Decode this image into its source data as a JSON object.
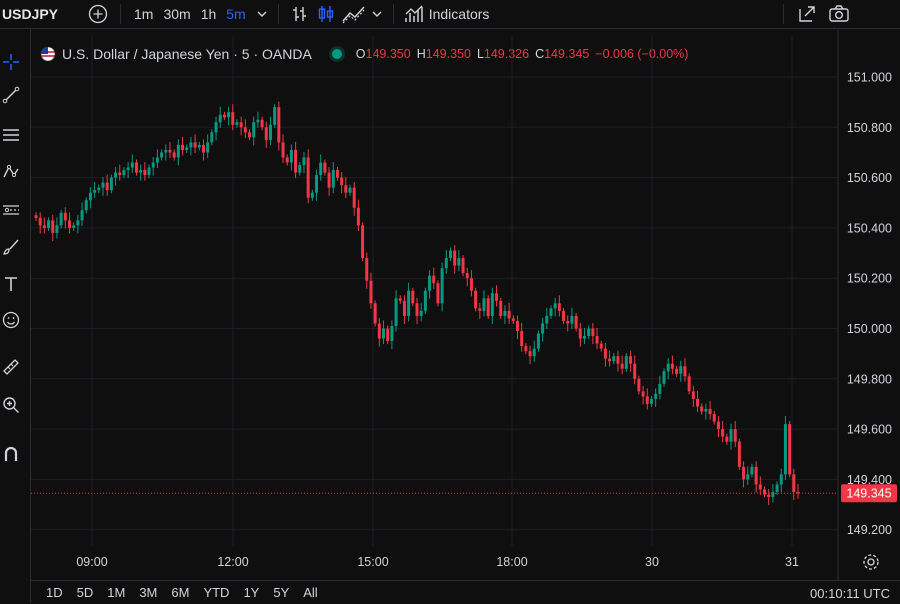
{
  "header": {
    "symbol": "USDJPY",
    "timeframes": [
      "1m",
      "30m",
      "1h",
      "5m"
    ],
    "active_timeframe": "5m",
    "indicators_label": "Indicators",
    "icons": [
      "add-symbol-icon",
      "chevron-down-icon",
      "bar-style-icon",
      "candle-style-icon",
      "area-style-icon",
      "indicators-icon",
      "snapshot-icon",
      "camera-icon"
    ]
  },
  "left_toolbar": {
    "icons": [
      "crosshair-icon",
      "trend-line-icon",
      "fib-icon",
      "pattern-icon",
      "projection-icon",
      "brush-icon",
      "text-icon",
      "emoji-icon",
      "ruler-icon",
      "zoom-icon",
      "magnet-icon"
    ]
  },
  "legend": {
    "title": "U.S. Dollar / Japanese Yen · 5 · OANDA",
    "open_label": "O",
    "open": "149.350",
    "high_label": "H",
    "high": "149.350",
    "low_label": "L",
    "low": "149.326",
    "close_label": "C",
    "close": "149.345",
    "change": "−0.006 (−0.00%)"
  },
  "price_axis": {
    "ticks": [
      "151.000",
      "150.800",
      "150.600",
      "150.400",
      "150.200",
      "150.000",
      "149.800",
      "149.600",
      "149.400",
      "149.200"
    ],
    "current_price": "149.345",
    "current_color": "#f23645"
  },
  "time_axis": {
    "ticks": [
      "09:00",
      "12:00",
      "15:00",
      "18:00",
      "30",
      "31"
    ]
  },
  "bottom_bar": {
    "ranges": [
      "1D",
      "5D",
      "1M",
      "3M",
      "6M",
      "YTD",
      "1Y",
      "5Y",
      "All"
    ],
    "clock": "00:10:11 UTC"
  },
  "colors": {
    "up": "#089981",
    "down": "#f23645",
    "background": "#0f0f0f",
    "accent": "#2962ff"
  },
  "chart_data": {
    "type": "candlestick",
    "ylim": [
      149.17,
      151.13
    ],
    "price_ticks": [
      151.0,
      150.8,
      150.6,
      150.4,
      150.2,
      150.0,
      149.8,
      149.6,
      149.4,
      149.2
    ],
    "current_price": 149.345,
    "closes": [
      150.44,
      150.41,
      150.4,
      150.43,
      150.38,
      150.41,
      150.46,
      150.43,
      150.4,
      150.41,
      150.43,
      150.47,
      150.51,
      150.54,
      150.55,
      150.56,
      150.58,
      150.55,
      150.6,
      150.62,
      150.61,
      150.63,
      150.64,
      150.66,
      150.62,
      150.63,
      150.61,
      150.64,
      150.66,
      150.68,
      150.7,
      150.71,
      150.7,
      150.68,
      150.73,
      150.71,
      150.72,
      150.74,
      150.72,
      150.73,
      150.7,
      150.74,
      150.78,
      150.82,
      150.85,
      150.84,
      150.86,
      150.81,
      150.82,
      150.8,
      150.78,
      150.76,
      150.82,
      150.83,
      150.8,
      150.75,
      150.81,
      150.88,
      150.74,
      150.68,
      150.66,
      150.71,
      150.62,
      150.65,
      150.68,
      150.52,
      150.54,
      150.61,
      150.66,
      150.62,
      150.56,
      150.63,
      150.6,
      150.57,
      150.54,
      150.56,
      150.48,
      150.41,
      150.28,
      150.19,
      150.1,
      150.02,
      149.96,
      150.0,
      149.95,
      150.01,
      150.12,
      150.11,
      150.05,
      150.15,
      150.1,
      150.05,
      150.07,
      150.15,
      150.21,
      150.18,
      150.1,
      150.24,
      150.28,
      150.31,
      150.25,
      150.28,
      150.22,
      150.2,
      150.15,
      150.08,
      150.07,
      150.12,
      150.05,
      150.14,
      150.11,
      150.05,
      150.07,
      150.04,
      150.03,
      149.99,
      149.93,
      149.91,
      149.89,
      149.92,
      149.98,
      150.02,
      150.05,
      150.08,
      150.1,
      150.07,
      150.03,
      150.02,
      150.05,
      150.0,
      149.96,
      149.97,
      150.0,
      149.97,
      149.94,
      149.92,
      149.88,
      149.87,
      149.89,
      149.86,
      149.84,
      149.89,
      149.86,
      149.8,
      149.75,
      149.73,
      149.7,
      149.72,
      149.74,
      149.78,
      149.83,
      149.86,
      149.84,
      149.82,
      149.85,
      149.81,
      149.75,
      149.72,
      149.69,
      149.67,
      149.68,
      149.66,
      149.63,
      149.6,
      149.57,
      149.55,
      149.6,
      149.55,
      149.45,
      149.4,
      149.42,
      149.45,
      149.38,
      149.36,
      149.34,
      149.33,
      149.35,
      149.38,
      149.42,
      149.62,
      149.42,
      149.35,
      149.345
    ]
  }
}
